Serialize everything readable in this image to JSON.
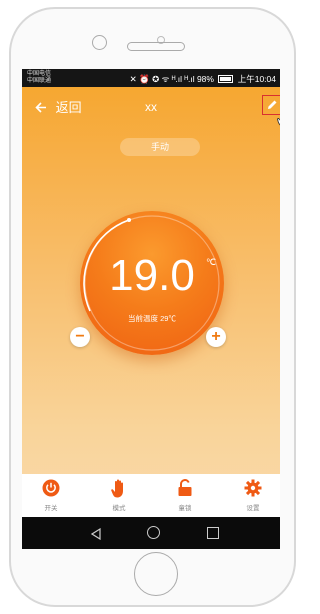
{
  "statusbar": {
    "carrier_line1": "中国电信",
    "carrier_line2": "中国联通",
    "icons_text": "✕ ⏰ ✪ ᯤ ᴴ.ıl ᴴ.ıl 98%",
    "time": "上午10:04"
  },
  "header": {
    "back_label": "返回",
    "title": "xx"
  },
  "mode_pill": "手动",
  "thermostat": {
    "set_temp": "19.0",
    "unit": "℃",
    "current_temp_label": "当前温度 29℃"
  },
  "tabs": [
    {
      "label": "开关",
      "icon": "power-icon"
    },
    {
      "label": "模式",
      "icon": "hand-icon"
    },
    {
      "label": "童锁",
      "icon": "unlock-icon"
    },
    {
      "label": "设置",
      "icon": "gear-icon"
    }
  ],
  "colors": {
    "accent": "#f07a12",
    "tab_icon": "#ef5a14",
    "highlight_box": "#d83030"
  }
}
